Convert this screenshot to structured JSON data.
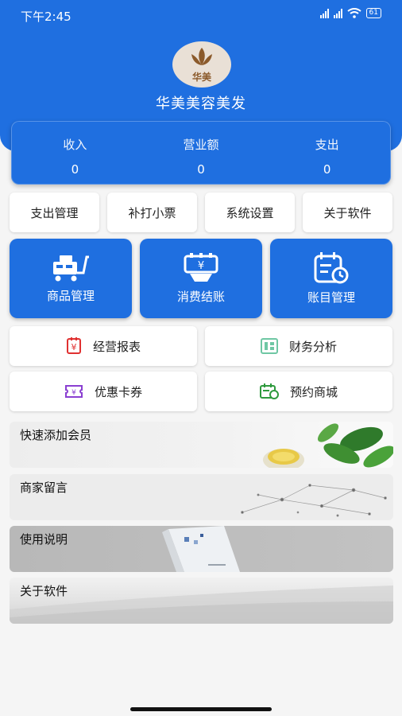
{
  "status": {
    "time": "下午2:45",
    "battery": "61"
  },
  "header": {
    "title": "华美美容美发",
    "logo_text": "华美"
  },
  "stats": [
    {
      "label": "收入",
      "value": "0"
    },
    {
      "label": "营业额",
      "value": "0"
    },
    {
      "label": "支出",
      "value": "0"
    }
  ],
  "quick_buttons": [
    "支出管理",
    "补打小票",
    "系统设置",
    "关于软件"
  ],
  "main_buttons": [
    {
      "label": "商品管理",
      "icon": "cart-icon"
    },
    {
      "label": "消费结账",
      "icon": "checkout-icon"
    },
    {
      "label": "账目管理",
      "icon": "ledger-icon"
    }
  ],
  "grid_buttons": [
    {
      "label": "经营报表",
      "icon": "yuan-report-icon",
      "color": "#e03131"
    },
    {
      "label": "财务分析",
      "icon": "layout-analysis-icon",
      "color": "#6fc7a4"
    },
    {
      "label": "优惠卡券",
      "icon": "coupon-icon",
      "color": "#8a3fd1"
    },
    {
      "label": "预约商城",
      "icon": "calendar-clock-icon",
      "color": "#2f9a3e"
    }
  ],
  "banners": [
    "快速添加会员",
    "商家留言",
    "使用说明",
    "关于软件"
  ],
  "colors": {
    "primary": "#1f6fe0",
    "background": "#f5f5f5"
  }
}
